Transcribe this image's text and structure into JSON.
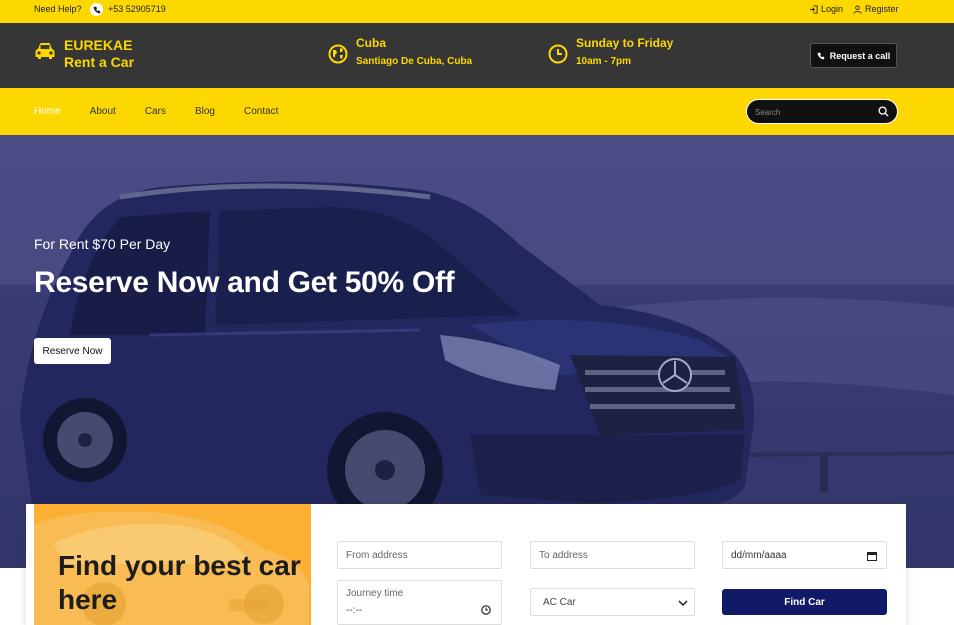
{
  "topbar": {
    "need_help": "Need Help?",
    "phone": "+53 52905719",
    "login": "Login",
    "register": "Register"
  },
  "header": {
    "brand_line1": "EUREKAE",
    "brand_line2": "Rent a Car",
    "location_title": "Cuba",
    "location_sub": "Santiago De Cuba, Cuba",
    "hours_title": "Sunday to Friday",
    "hours_sub": "10am - 7pm",
    "request_call": "Request a call"
  },
  "nav": {
    "items": [
      {
        "label": "Home",
        "active": true
      },
      {
        "label": "About",
        "active": false
      },
      {
        "label": "Cars",
        "active": false
      },
      {
        "label": "Blog",
        "active": false
      },
      {
        "label": "Contact",
        "active": false
      }
    ],
    "search_placeholder": "Search"
  },
  "hero": {
    "subtitle": "For Rent $70 Per Day",
    "title": "Reserve Now and Get 50% Off",
    "button": "Reserve Now"
  },
  "booking": {
    "promo_title": "Find your best car here",
    "from_placeholder": "From address",
    "to_placeholder": "To address",
    "date_value": "dd/mm/aaaa",
    "journey_label": "Journey time",
    "journey_value": "--:--",
    "car_type_selected": "AC Car",
    "find_button": "Find Car"
  },
  "colors": {
    "brand_yellow": "#fcd800",
    "header_dark": "#363636",
    "find_button": "#111a66",
    "promo_orange": "#fbb034"
  },
  "icons": [
    "phone-icon",
    "login-icon",
    "user-icon",
    "car-icon",
    "globe-icon",
    "clock-icon",
    "search-icon"
  ]
}
